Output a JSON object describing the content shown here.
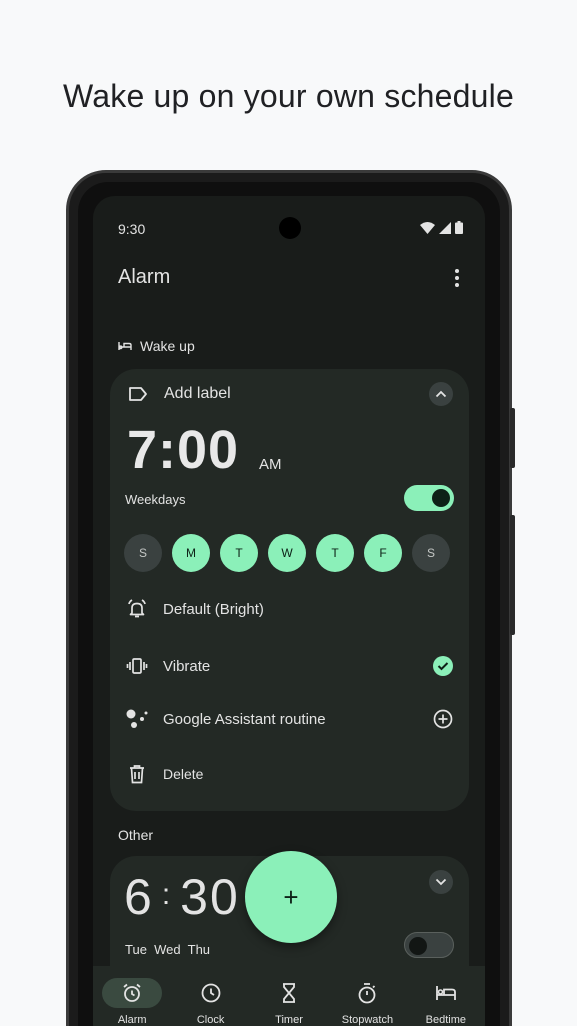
{
  "headline": "Wake up on your own schedule",
  "status": {
    "time": "9:30"
  },
  "app": {
    "title": "Alarm"
  },
  "sections": {
    "wake_up": "Wake up",
    "other": "Other"
  },
  "alarm1": {
    "label": "Add label",
    "time": "7:00",
    "ampm": "AM",
    "repeat": "Weekdays",
    "enabled": true,
    "days": [
      {
        "letter": "S",
        "on": false
      },
      {
        "letter": "M",
        "on": true
      },
      {
        "letter": "T",
        "on": true
      },
      {
        "letter": "W",
        "on": true
      },
      {
        "letter": "T",
        "on": true
      },
      {
        "letter": "F",
        "on": true
      },
      {
        "letter": "S",
        "on": false
      }
    ],
    "ringtone": "Default (Bright)",
    "vibrate": "Vibrate",
    "vibrate_checked": true,
    "assistant": "Google Assistant routine",
    "delete": "Delete"
  },
  "alarm2": {
    "time_hour": "6",
    "time_sep": ":",
    "time_min": "30",
    "days": "Tue  Wed  Thu",
    "enabled": false
  },
  "fab": {
    "symbol": "+"
  },
  "nav": [
    {
      "label": "Alarm",
      "icon": "alarm-icon",
      "active": true
    },
    {
      "label": "Clock",
      "icon": "clock-icon",
      "active": false
    },
    {
      "label": "Timer",
      "icon": "hourglass-icon",
      "active": false
    },
    {
      "label": "Stopwatch",
      "icon": "stopwatch-icon",
      "active": false
    },
    {
      "label": "Bedtime",
      "icon": "bed-icon",
      "active": false
    }
  ],
  "colors": {
    "accent": "#8bf0b9",
    "card": "#232925",
    "screen": "#191c1a"
  }
}
